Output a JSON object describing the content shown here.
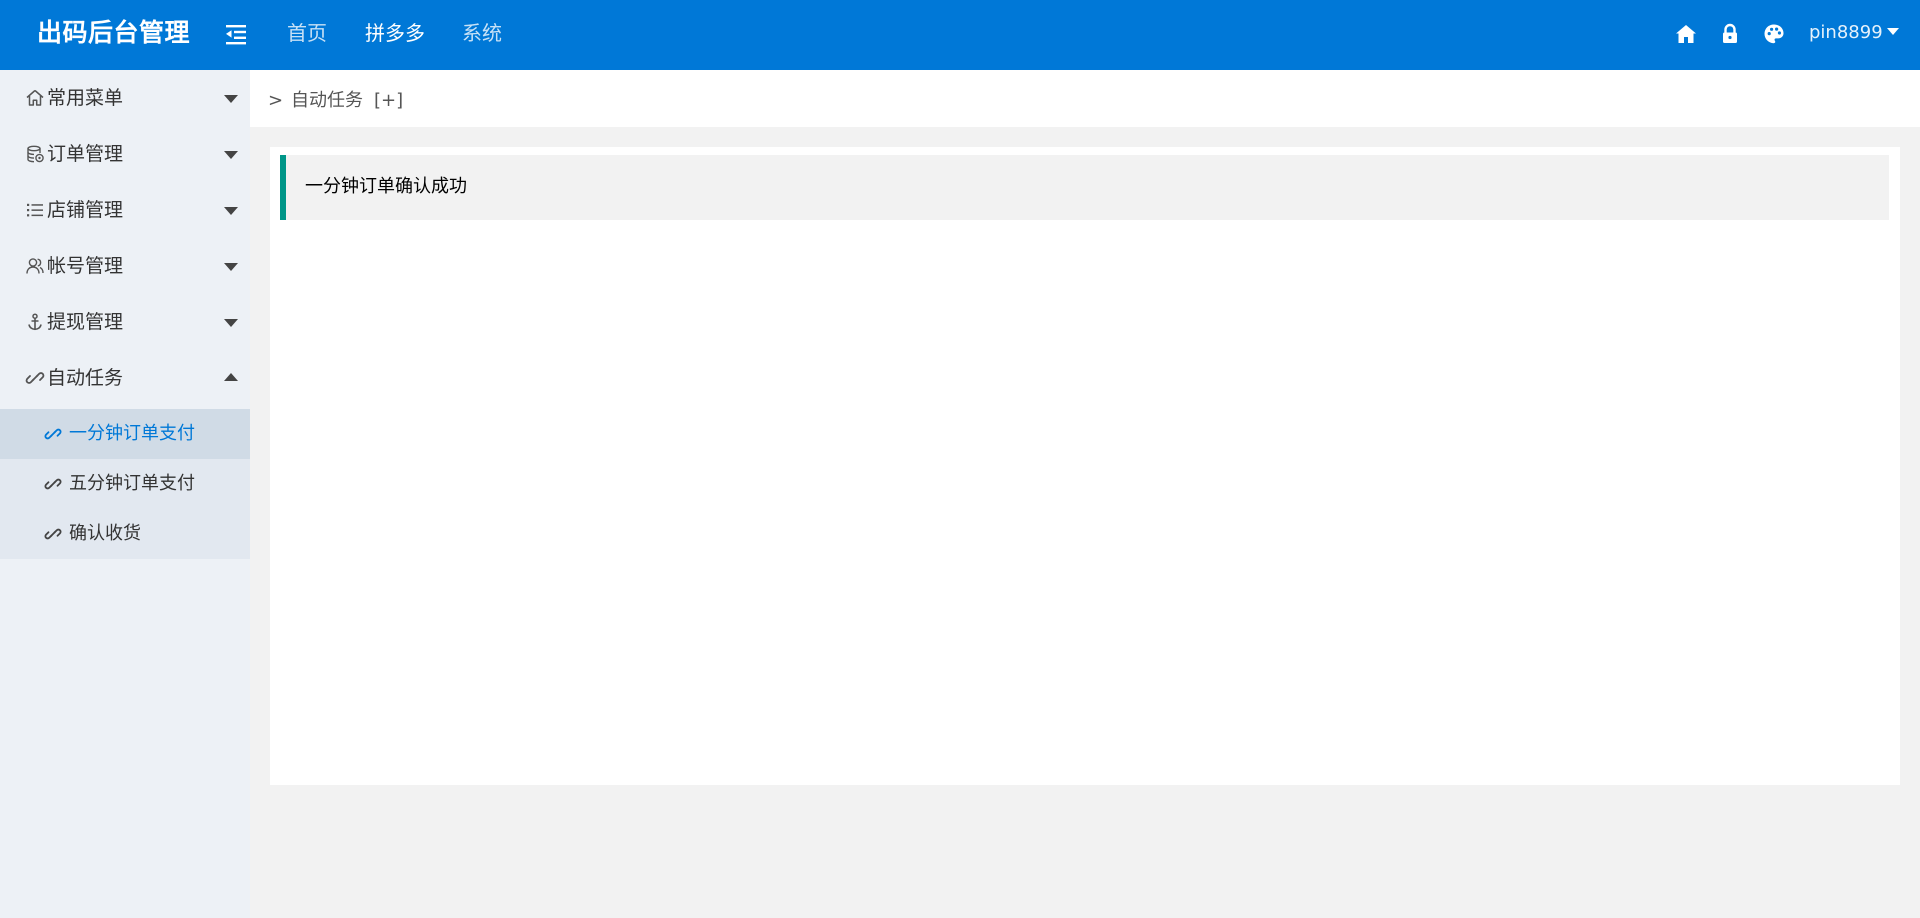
{
  "header": {
    "logo": "出码后台管理",
    "nav": [
      "首页",
      "拼多多",
      "系统"
    ],
    "active_nav": "拼多多",
    "icons": [
      "home-icon",
      "lock-icon",
      "palette-icon"
    ],
    "user": "pin8899"
  },
  "sidebar": {
    "items": [
      {
        "label": "常用菜单",
        "icon": "home-outline-icon",
        "expanded": false
      },
      {
        "label": "订单管理",
        "icon": "database-icon",
        "expanded": false
      },
      {
        "label": "店铺管理",
        "icon": "list-icon",
        "expanded": false
      },
      {
        "label": "帐号管理",
        "icon": "users-icon",
        "expanded": false
      },
      {
        "label": "提现管理",
        "icon": "anchor-icon",
        "expanded": false
      },
      {
        "label": "自动任务",
        "icon": "link-icon",
        "expanded": true
      }
    ],
    "subitems": [
      {
        "label": "一分钟订单支付",
        "icon": "link-icon",
        "active": true
      },
      {
        "label": "五分钟订单支付",
        "icon": "link-icon",
        "active": false
      },
      {
        "label": "确认收货",
        "icon": "link-icon",
        "active": false
      }
    ]
  },
  "breadcrumb": {
    "separator": ">",
    "title": "自动任务",
    "add": "[+]"
  },
  "content": {
    "message": "一分钟订单确认成功"
  },
  "colors": {
    "header_bg": "#0078d7",
    "sidebar_bg": "#edf1f6",
    "active_text": "#0078d7",
    "alert_border": "#009688"
  }
}
